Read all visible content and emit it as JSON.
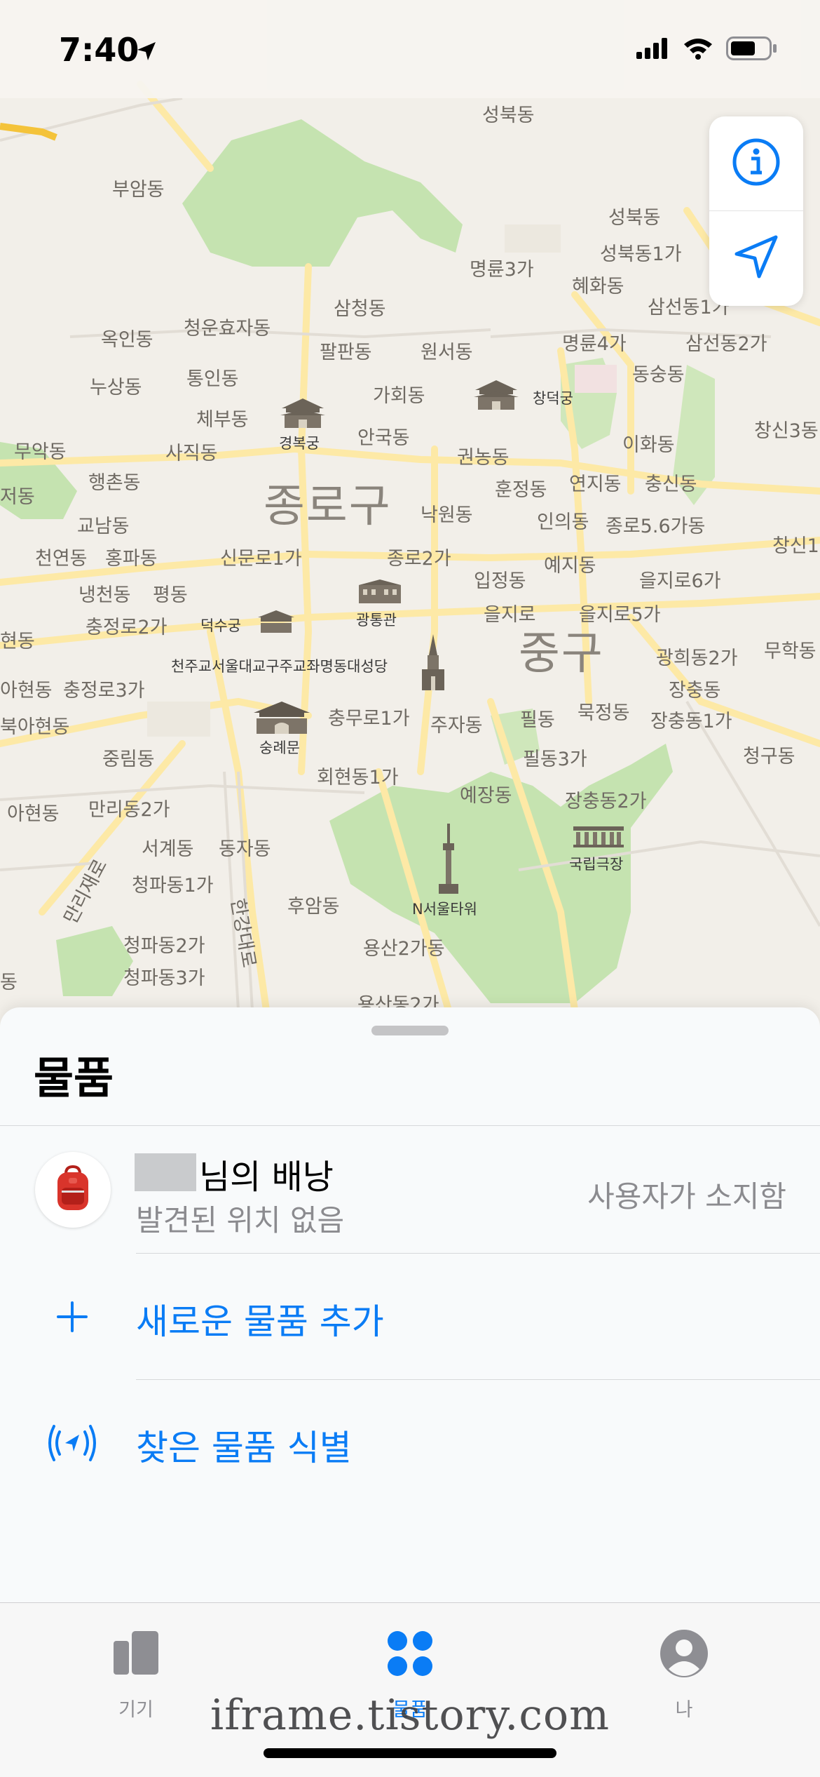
{
  "status_bar": {
    "time": "7:40"
  },
  "map": {
    "districts": [
      {
        "id": "jongno",
        "text": "종로구"
      },
      {
        "id": "jung",
        "text": "중구"
      }
    ],
    "neighborhoods": [
      {
        "text": "성북동"
      },
      {
        "text": "부암동"
      },
      {
        "text": "성북동"
      },
      {
        "text": "성북동1가"
      },
      {
        "text": "명륜3가"
      },
      {
        "text": "혜화동"
      },
      {
        "text": "삼선동1가"
      },
      {
        "text": "삼청동"
      },
      {
        "text": "옥인동"
      },
      {
        "text": "청운효자동"
      },
      {
        "text": "팔판동"
      },
      {
        "text": "원서동"
      },
      {
        "text": "명륜4가"
      },
      {
        "text": "삼선동2가"
      },
      {
        "text": "누상동"
      },
      {
        "text": "통인동"
      },
      {
        "text": "동숭동"
      },
      {
        "text": "가회동"
      },
      {
        "text": "체부동"
      },
      {
        "text": "무악동"
      },
      {
        "text": "사직동"
      },
      {
        "text": "안국동"
      },
      {
        "text": "이화동"
      },
      {
        "text": "창신3동"
      },
      {
        "text": "권농동"
      },
      {
        "text": "행촌동"
      },
      {
        "text": "훈정동"
      },
      {
        "text": "연지동"
      },
      {
        "text": "충신동"
      },
      {
        "text": "저동"
      },
      {
        "text": "낙원동"
      },
      {
        "text": "교남동"
      },
      {
        "text": "인의동"
      },
      {
        "text": "종로5.6가동"
      },
      {
        "text": "천연동"
      },
      {
        "text": "홍파동"
      },
      {
        "text": "신문로1가"
      },
      {
        "text": "종로2가"
      },
      {
        "text": "창신1"
      },
      {
        "text": "입정동"
      },
      {
        "text": "예지동"
      },
      {
        "text": "을지로6가"
      },
      {
        "text": "냉천동"
      },
      {
        "text": "평동"
      },
      {
        "text": "충정로2가"
      },
      {
        "text": "을지로"
      },
      {
        "text": "을지로5가"
      },
      {
        "text": "현동"
      },
      {
        "text": "광희동2가"
      },
      {
        "text": "무학동"
      },
      {
        "text": "아현동"
      },
      {
        "text": "충정로3가"
      },
      {
        "text": "장충동"
      },
      {
        "text": "북아현동"
      },
      {
        "text": "충무로1가"
      },
      {
        "text": "주자동"
      },
      {
        "text": "필동"
      },
      {
        "text": "묵정동"
      },
      {
        "text": "장충동1가"
      },
      {
        "text": "중림동"
      },
      {
        "text": "필동3가"
      },
      {
        "text": "청구동"
      },
      {
        "text": "회현동1가"
      },
      {
        "text": "아현동"
      },
      {
        "text": "만리동2가"
      },
      {
        "text": "예장동"
      },
      {
        "text": "장충동2가"
      },
      {
        "text": "서계동"
      },
      {
        "text": "동자동"
      },
      {
        "text": "만리재로"
      },
      {
        "text": "청파동1가"
      },
      {
        "text": "후암동"
      },
      {
        "text": "한강대로"
      },
      {
        "text": "청파동2가"
      },
      {
        "text": "용산2가동"
      },
      {
        "text": "청파동3가"
      },
      {
        "text": "동"
      },
      {
        "text": "용산동2가"
      }
    ],
    "pois": [
      {
        "id": "gyeongbokgung",
        "text": "경복궁"
      },
      {
        "id": "changdeokgung",
        "text": "창덕궁"
      },
      {
        "id": "gwangtonggwan",
        "text": "광통관"
      },
      {
        "id": "deoksugung",
        "text": "덕수궁"
      },
      {
        "id": "cathedral",
        "text": "천주교서울대교구주교좌명동대성당"
      },
      {
        "id": "sungnyemun",
        "text": "숭례문"
      },
      {
        "id": "namsan",
        "text": "N서울타워"
      },
      {
        "id": "theater",
        "text": "국립극장"
      }
    ]
  },
  "sheet": {
    "title": "물품",
    "items": [
      {
        "name": "님의 배낭",
        "status": "발견된 위치 없음",
        "owner": "사용자가 소지함",
        "icon": "backpack-icon"
      }
    ],
    "actions": [
      {
        "label": "새로운 물품 추가",
        "icon": "plus-icon"
      },
      {
        "label": "찾은 물품 식별",
        "icon": "identify-signal-icon"
      }
    ]
  },
  "tabs": [
    {
      "label": "기기",
      "icon": "devices-icon",
      "active": false
    },
    {
      "label": "물품",
      "icon": "items-icon",
      "active": true
    },
    {
      "label": "나",
      "icon": "person-icon",
      "active": false
    }
  ],
  "watermark": "iframe.tistory.com",
  "colors": {
    "accent": "#0a7cf5",
    "park": "#c5e3b0",
    "road": "#fde9a6"
  }
}
